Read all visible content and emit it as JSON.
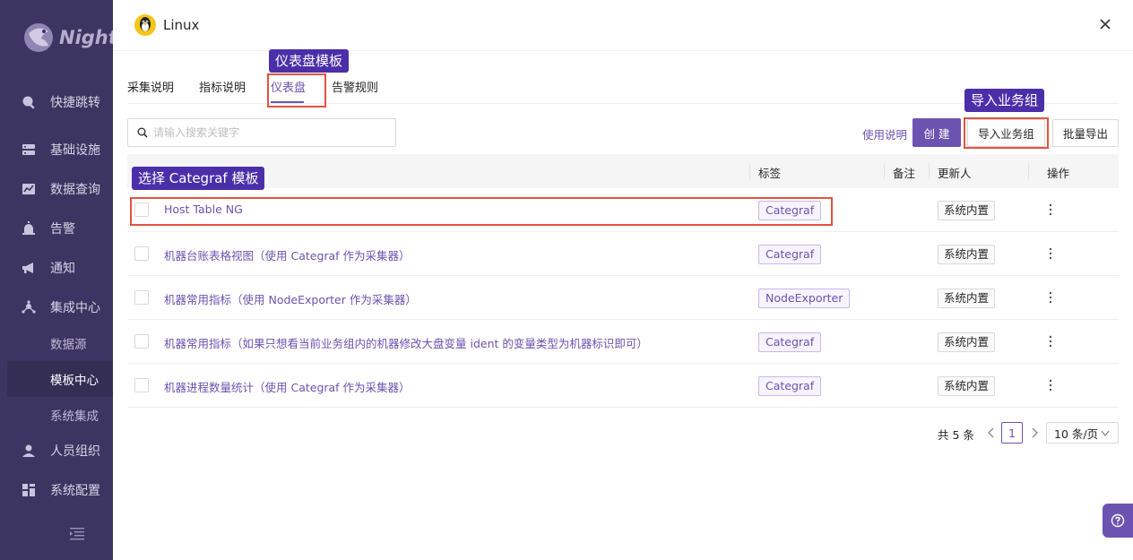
{
  "sidebar": {
    "logo_text": "Nighting",
    "items": [
      {
        "label": "快捷跳转",
        "icon": "search-icon"
      },
      {
        "label": "基础设施",
        "icon": "server-icon"
      },
      {
        "label": "数据查询",
        "icon": "chart-icon"
      },
      {
        "label": "告警",
        "icon": "alarm-icon"
      },
      {
        "label": "通知",
        "icon": "megaphone-icon"
      },
      {
        "label": "集成中心",
        "icon": "integration-icon"
      },
      {
        "label": "数据源",
        "icon": ""
      },
      {
        "label": "模板中心",
        "icon": ""
      },
      {
        "label": "系统集成",
        "icon": ""
      },
      {
        "label": "人员组织",
        "icon": "user-icon"
      },
      {
        "label": "系统配置",
        "icon": "settings-grid-icon"
      }
    ]
  },
  "drawer": {
    "title": "Linux",
    "tabs": [
      "采集说明",
      "指标说明",
      "仪表盘",
      "告警规则"
    ],
    "active_tab": "仪表盘",
    "search_placeholder": "请输入搜索关键字",
    "usage_link": "使用说明",
    "create_label": "创 建",
    "import_label": "导入业务组",
    "export_label": "批量导出",
    "columns": {
      "tags": "标签",
      "note": "备注",
      "updated_by": "更新人",
      "actions": "操作"
    },
    "rows": [
      {
        "name": "Host Table NG",
        "tag": "Categraf",
        "updated_by": "系统内置"
      },
      {
        "name": "机器台账表格视图（使用 Categraf 作为采集器）",
        "tag": "Categraf",
        "updated_by": "系统内置"
      },
      {
        "name": "机器常用指标（使用 NodeExporter 作为采集器）",
        "tag": "NodeExporter",
        "updated_by": "系统内置"
      },
      {
        "name": "机器常用指标（如果只想看当前业务组内的机器修改大盘变量 ident 的变量类型为机器标识即可）",
        "tag": "Categraf",
        "updated_by": "系统内置"
      },
      {
        "name": "机器进程数量统计（使用 Categraf 作为采集器）",
        "tag": "Categraf",
        "updated_by": "系统内置"
      }
    ],
    "pagination": {
      "total": "共 5 条",
      "current": "1",
      "page_size": "10 条/页"
    }
  },
  "annotations": {
    "dashboard_template": "仪表盘模板",
    "import_group": "导入业务组",
    "select_categraf": "选择 Categraf 模板"
  },
  "colors": {
    "sidebar_bg": "#3d3561",
    "accent": "#6c53b1",
    "callout_bg": "#4b2fa9",
    "highlight_border": "#e1533f"
  }
}
